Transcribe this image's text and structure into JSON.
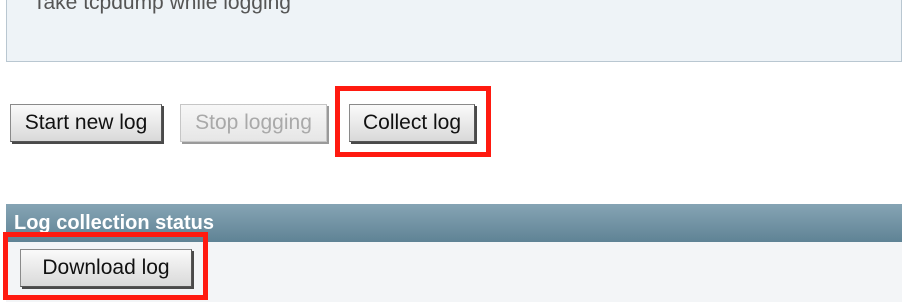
{
  "options_panel": {
    "text": "Take tcpdump while logging"
  },
  "buttons": {
    "start": "Start new log",
    "stop": "Stop logging",
    "collect": "Collect log",
    "download": "Download log"
  },
  "status_section": {
    "title": "Log collection status"
  },
  "colors": {
    "highlight": "#ff1a10",
    "section_header": "#6f8fa1"
  }
}
